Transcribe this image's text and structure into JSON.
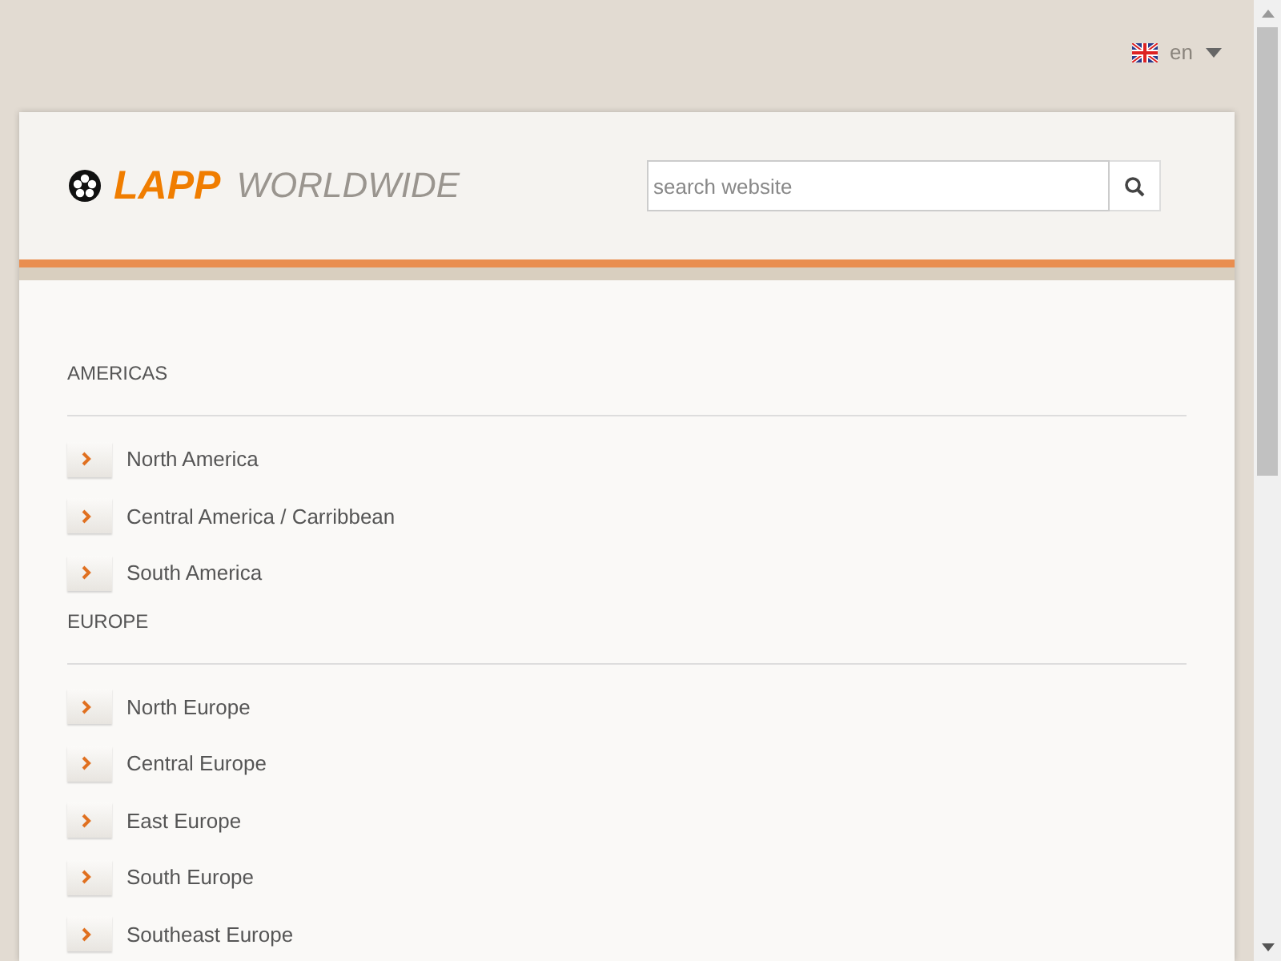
{
  "language": {
    "label": "en"
  },
  "header": {
    "brand": "LAPP",
    "subtitle": "WORLDWIDE",
    "search": {
      "placeholder": "search website"
    }
  },
  "regions": [
    {
      "title": "AMERICAS",
      "items": [
        "North America",
        "Central America / Carribbean",
        "South America"
      ]
    },
    {
      "title": "EUROPE",
      "items": [
        "North Europe",
        "Central Europe",
        "East Europe",
        "South Europe",
        "Southeast Europe"
      ]
    }
  ]
}
